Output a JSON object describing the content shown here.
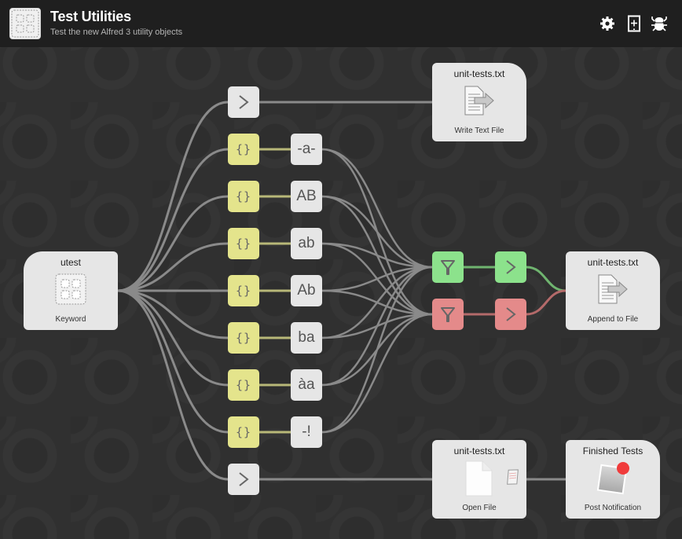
{
  "header": {
    "title": "Test Utilities",
    "subtitle": "Test the new Alfred 3 utility objects",
    "actions": [
      {
        "name": "settings",
        "icon": "gear-icon"
      },
      {
        "name": "add-object",
        "icon": "add-tablet-icon"
      },
      {
        "name": "debugger",
        "icon": "bug-icon"
      }
    ]
  },
  "nodes": {
    "keyword": {
      "title": "utest",
      "type": "Keyword"
    },
    "write_file": {
      "title": "unit-tests.txt",
      "type": "Write Text File"
    },
    "append_file": {
      "title": "unit-tests.txt",
      "type": "Append to File"
    },
    "open_file": {
      "title": "unit-tests.txt",
      "type": "Open File"
    },
    "notification": {
      "title": "Finished Tests",
      "type": "Post Notification"
    },
    "transforms": [
      {
        "label": "-a-"
      },
      {
        "label": "AB"
      },
      {
        "label": "ab"
      },
      {
        "label": "Ab"
      },
      {
        "label": "ba"
      },
      {
        "label": "àa"
      },
      {
        "label": "-!"
      }
    ],
    "brace_label": "{}",
    "colors": {
      "arg_var": "#e4e48c",
      "filter_pass": "#8ce28c",
      "filter_fail": "#e48a8a",
      "wire": "#8a8a8a",
      "wire_arg": "#b8b878",
      "wire_pass": "#6fb46f",
      "wire_fail": "#b46a6a"
    }
  }
}
